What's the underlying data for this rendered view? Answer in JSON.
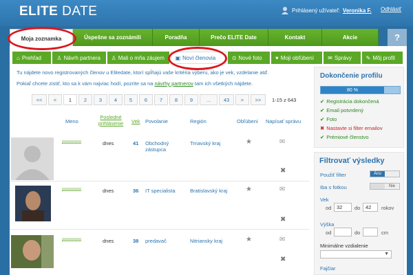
{
  "header": {
    "logo_bold": "ELITE",
    "logo_light": "DATE",
    "logged_in_label": "Prihlásený užívateľ:",
    "user_name": "Veronika F.",
    "logout": "Odhlásiť"
  },
  "main_nav": [
    {
      "label": "Moja zoznamka"
    },
    {
      "label": "Úspešne sa zoznámili"
    },
    {
      "label": "Poradňa"
    },
    {
      "label": "Prečo ELITE Date"
    },
    {
      "label": "Kontakt"
    },
    {
      "label": "Akcie"
    }
  ],
  "help": "?",
  "sub_nav": [
    {
      "label": "Prehľad",
      "icon": "home-icon"
    },
    {
      "label": "Návrh partnera",
      "icon": "user-icon"
    },
    {
      "label": "Mali o mňa záujem",
      "icon": "people-icon"
    },
    {
      "label": "Noví členovia",
      "icon": "member-icon"
    },
    {
      "label": "Nové foto",
      "icon": "search-icon"
    },
    {
      "label": "Moji obľúbení",
      "icon": "heart-icon"
    },
    {
      "label": "Správy",
      "icon": "chat-icon"
    },
    {
      "label": "Môj profil",
      "icon": "pencil-icon"
    }
  ],
  "info": {
    "line1": "Tu nájdete novo registrovaných členov u Elitedate, ktorí spĺňajú vaše kritéria výberu, ako je vek, vzdelanie atď.",
    "line2_a": "Pokiaľ chcete zistiť, kto sa k vám najviac hodí, pozrite sa na ",
    "line2_link": "návrhy partnerov",
    "line2_b": " tam ich všetkých nájdete."
  },
  "pager": [
    "<<",
    "<",
    "1",
    "2",
    "3",
    "4",
    "5",
    "6",
    "7",
    "8",
    "9",
    "...",
    "43",
    ">",
    ">>"
  ],
  "pager_current": "1",
  "range": "1-15 z 643",
  "table": {
    "headers": {
      "name": "Meno",
      "last_login": "Posledné prihlásenie",
      "age": "Vek",
      "job": "Povolanie",
      "region": "Región",
      "fav": "Obľúbení",
      "write": "Napísať správu"
    },
    "rows": [
      {
        "last_login": "dnes",
        "age": "41",
        "job": "Obchodný zástupca",
        "region": "Trnavský kraj"
      },
      {
        "last_login": "dnes",
        "age": "36",
        "job": "IT specialista",
        "region": "Bratislavský kraj"
      },
      {
        "last_login": "dnes",
        "age": "38",
        "job": "predavač",
        "region": "Nitriansky kraj"
      }
    ]
  },
  "profile_completion": {
    "title": "Dokončenie profilu",
    "percent": 80,
    "percent_label": "80 %",
    "items": [
      {
        "label": "Registrácia dokončená",
        "ok": true
      },
      {
        "label": "Email potvrdený",
        "ok": true
      },
      {
        "label": "Foto",
        "ok": true
      },
      {
        "label": "Nastavte si filter emailov",
        "ok": false
      },
      {
        "label": "Prémiové členstvo",
        "ok": true
      }
    ]
  },
  "filter": {
    "title": "Filtrovať výsledky",
    "use_filter": "Použiť filter",
    "use_filter_on": "Áno",
    "photo_only": "Iba s fotkou",
    "photo_only_off": "Nie",
    "age": "Vek",
    "from": "od",
    "to": "do",
    "age_from": "32",
    "age_to": "42",
    "years": "rokov",
    "height": "Výška",
    "cm": "cm",
    "min_distance": "Minimálne vzdialenie",
    "smoker": "Fajčiar"
  },
  "colors": {
    "brand_blue": "#2e74ad",
    "nav_green": "#5aa826",
    "highlight_red": "#d9181e"
  }
}
